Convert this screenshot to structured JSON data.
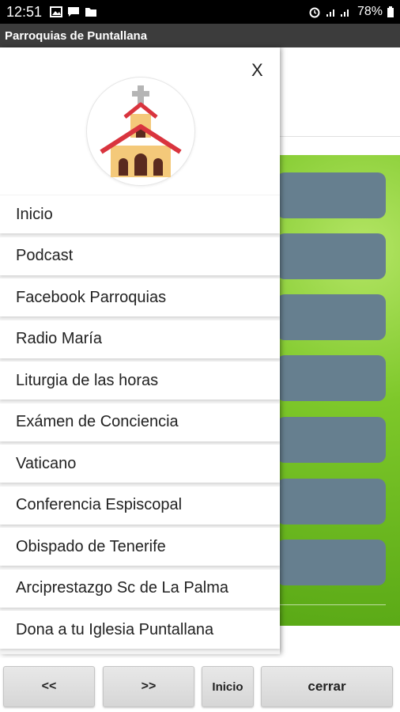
{
  "status_bar": {
    "time": "12:51",
    "battery": "78%"
  },
  "app": {
    "title": "Parroquias de Puntallana"
  },
  "drawer": {
    "close_label": "X",
    "logo_icon": "church-icon",
    "items": [
      {
        "label": "Inicio"
      },
      {
        "label": "Podcast"
      },
      {
        "label": "Facebook Parroquias"
      },
      {
        "label": "Radio María"
      },
      {
        "label": "Liturgia de las horas"
      },
      {
        "label": "Exámen de Conciencia"
      },
      {
        "label": "Vaticano"
      },
      {
        "label": "Conferencia Espiscopal"
      },
      {
        "label": "Obispado de Tenerife"
      },
      {
        "label": "Arciprestazgo Sc de La Palma"
      },
      {
        "label": "Dona a tu Iglesia Puntallana"
      }
    ]
  },
  "bottom_nav": {
    "prev_label": "<<",
    "next_label": ">>",
    "home_label": "Inicio",
    "close_label": "cerrar"
  },
  "colors": {
    "titlebar": "#3c3c3c",
    "green_panel": "#7ec82a",
    "panel_button": "#667f8f",
    "church_wall": "#f4c97a",
    "church_roof": "#d9343e"
  }
}
